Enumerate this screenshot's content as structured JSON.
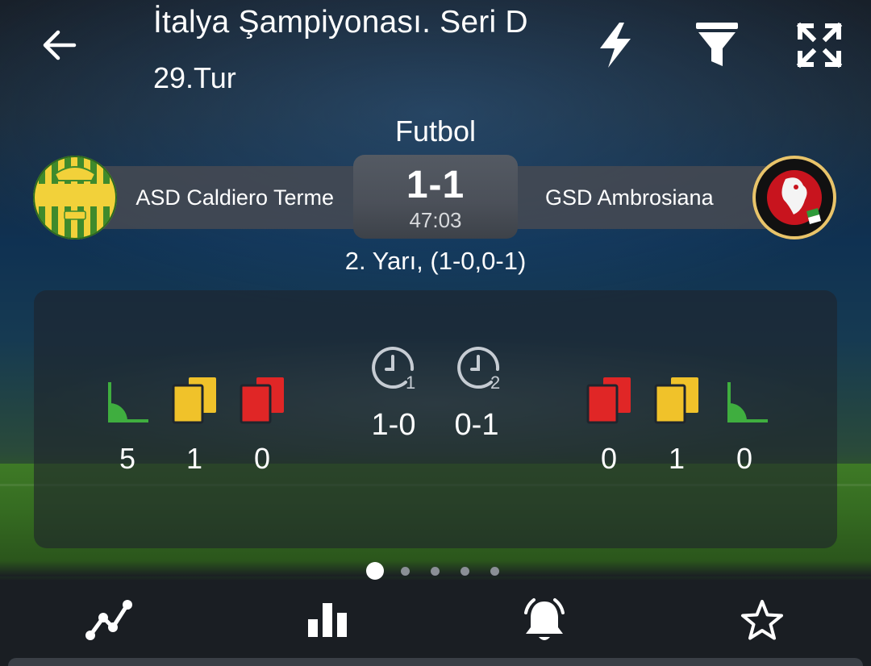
{
  "header": {
    "title": "İtalya Şampiyonası. Seri D",
    "round": "29.Tur",
    "icons": [
      "back-arrow-icon",
      "lightning-icon",
      "filter-icon",
      "expand-icon"
    ]
  },
  "match": {
    "sport": "Futbol",
    "home": {
      "name": "ASD Caldiero Terme",
      "logo_icon": "caldiero-crest-icon"
    },
    "away": {
      "name": "GSD Ambrosiana",
      "logo_icon": "ambrosiana-crest-icon"
    },
    "score": "1-1",
    "clock": "47:03",
    "period": "2. Yarı, (1-0,0-1)"
  },
  "stats": {
    "home": {
      "corners": "5",
      "yellow_cards": "1",
      "red_cards": "0"
    },
    "away": {
      "red_cards": "0",
      "yellow_cards": "1",
      "corners": "0"
    },
    "halves": [
      {
        "icon": "first-half-clock-icon",
        "score": "1-0"
      },
      {
        "icon": "second-half-clock-icon",
        "score": "0-1"
      }
    ],
    "colors": {
      "corner": "#3fae3f",
      "yellow": "#f0c22a",
      "red": "#e02626"
    }
  },
  "pager": {
    "count": 5,
    "active": 0
  },
  "bottom_nav": [
    "line-chart-icon",
    "bar-chart-icon",
    "alarm-bell-icon",
    "star-icon"
  ]
}
